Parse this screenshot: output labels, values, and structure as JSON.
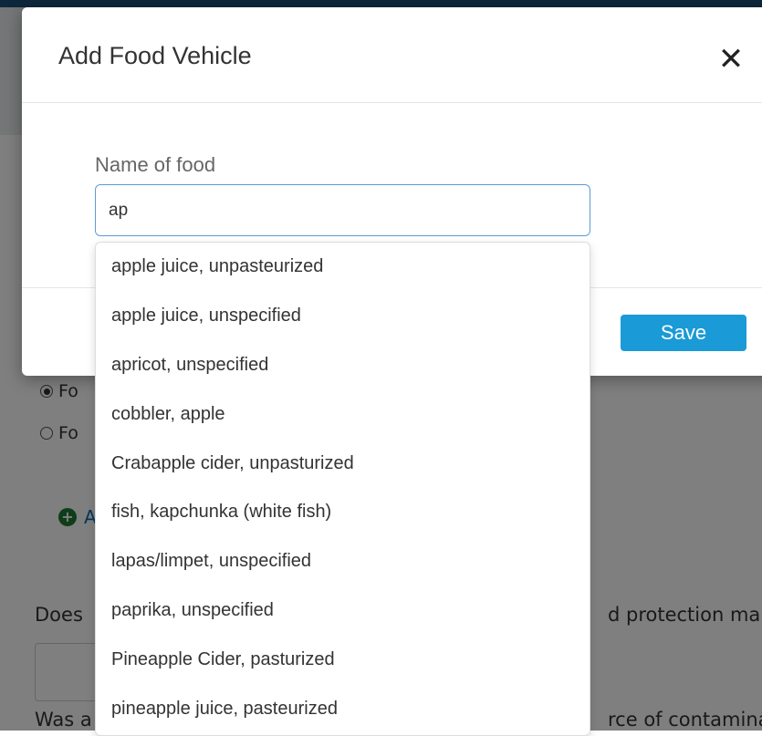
{
  "background": {
    "radio_options": [
      {
        "label": "Fo",
        "checked": true
      },
      {
        "label": "Fo",
        "checked": false
      }
    ],
    "add_link": "A",
    "question1_left": "Does",
    "question1_right": "d protection ma",
    "question2_left": "Was a",
    "question2_right": "rce of contamina"
  },
  "modal": {
    "title": "Add Food Vehicle",
    "close_symbol": "✕",
    "field_label": "Name of food",
    "input_value": "ap",
    "save_label": "Save"
  },
  "suggestions": [
    "apple juice, unpasteurized",
    "apple juice, unspecified",
    "apricot, unspecified",
    "cobbler, apple",
    "Crabapple cider, unpasturized",
    "fish, kapchunka (white fish)",
    "lapas/limpet, unspecified",
    "paprika, unspecified",
    "Pineapple Cider, pasturized",
    "pineapple juice, pasteurized"
  ],
  "colors": {
    "primary": "#1a9ad6",
    "input_focus_border": "#5b9bd5",
    "add_icon": "#1e7b34",
    "link": "#0b6bb3"
  }
}
